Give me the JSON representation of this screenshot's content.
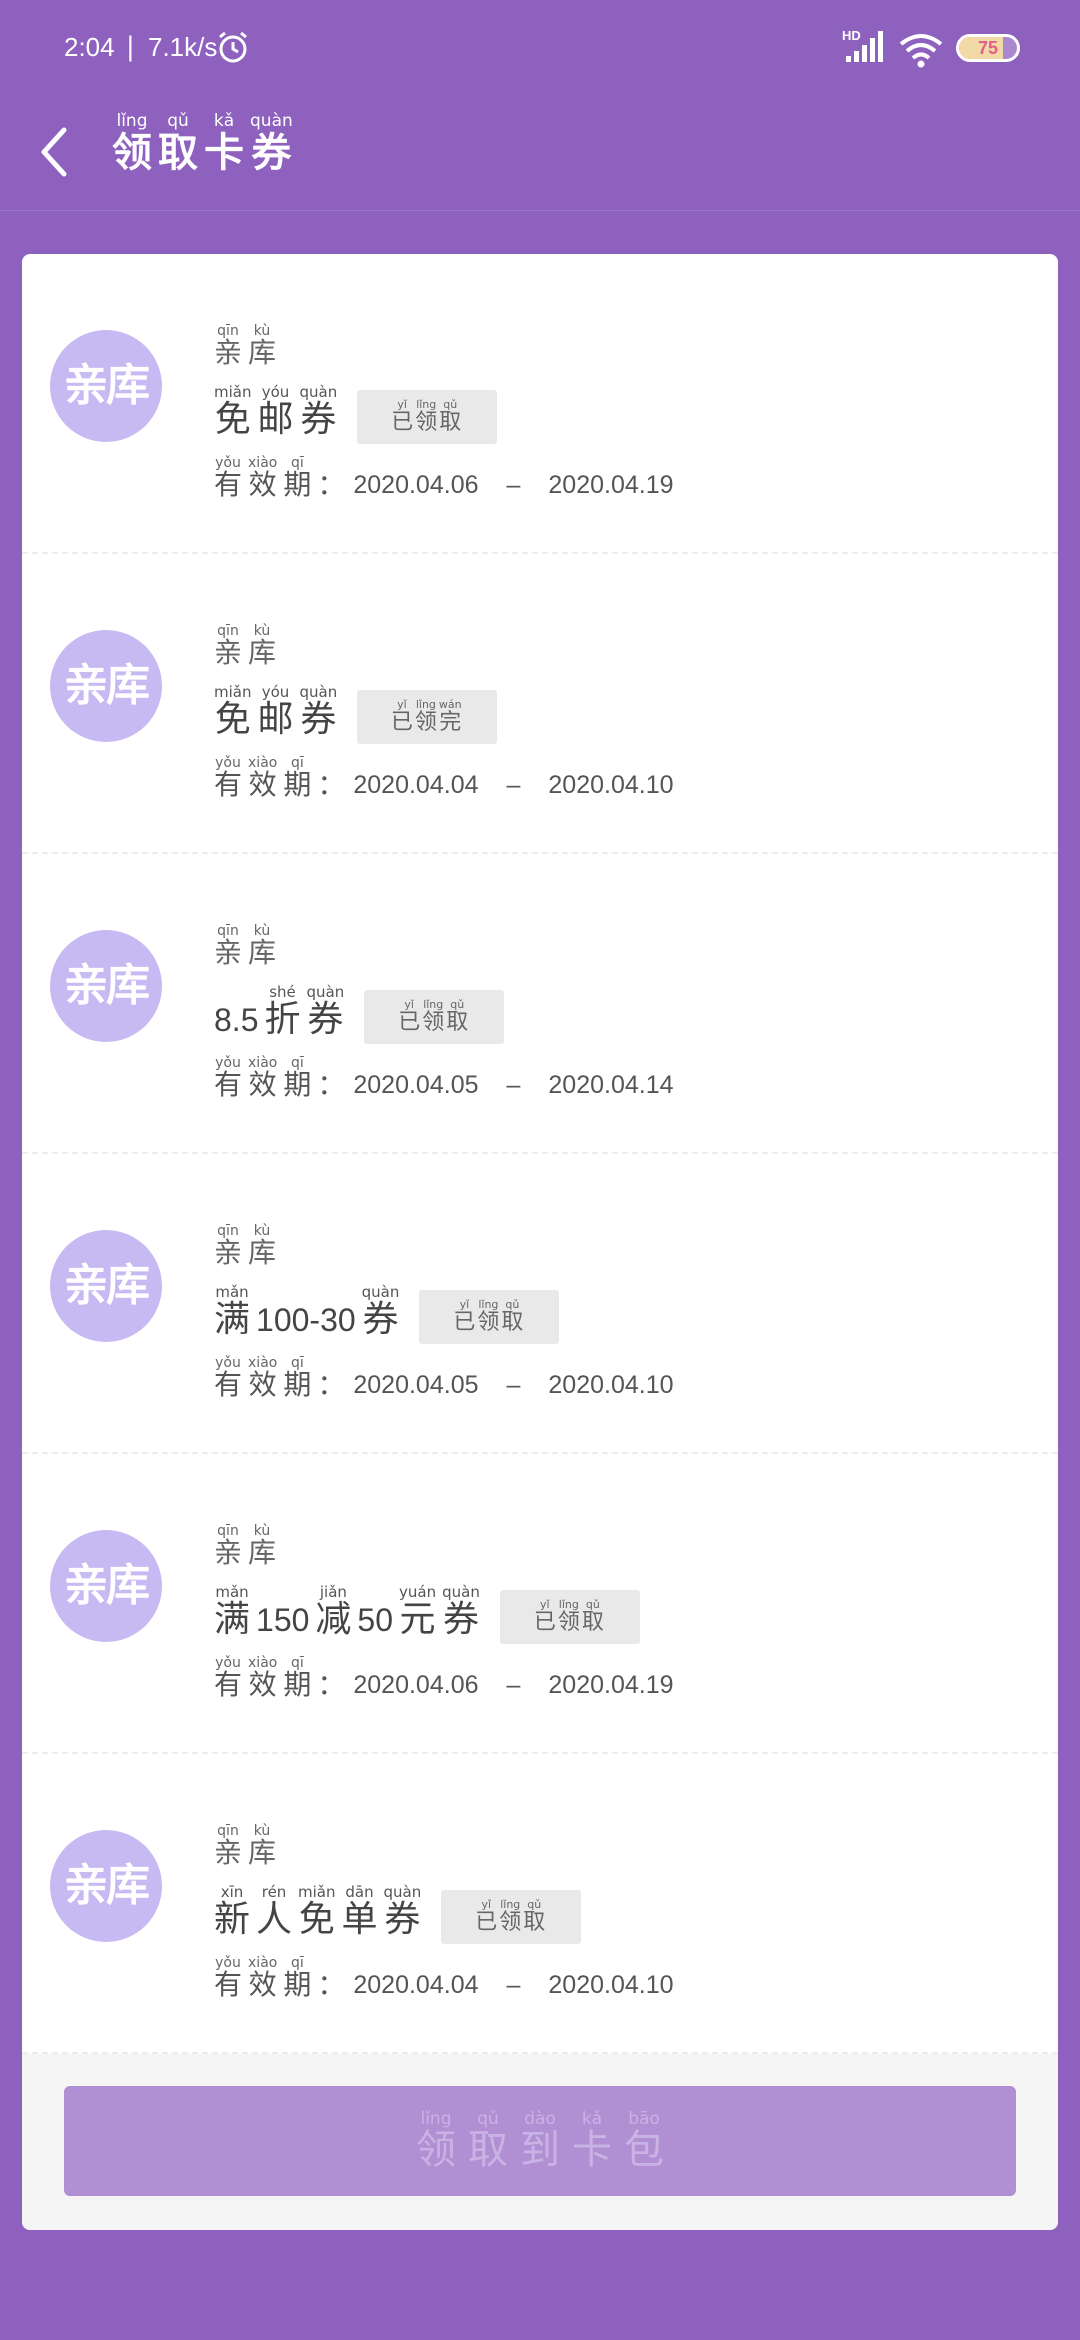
{
  "status_bar": {
    "time": "2:04",
    "separator": "|",
    "speed": "7.1k/s",
    "battery": "75",
    "battery_level": 0.75
  },
  "header": {
    "title": [
      {
        "py": "lǐng",
        "ch": "领"
      },
      {
        "py": "qǔ",
        "ch": "取"
      },
      {
        "py": "kǎ",
        "ch": "卡"
      },
      {
        "py": "quàn",
        "ch": "券"
      }
    ]
  },
  "colors": {
    "background": "#8e61bf",
    "button": "#b08fd2",
    "logo": "#c7b9f2"
  },
  "coupons": [
    {
      "logo": "亲库",
      "brand": [
        {
          "py": "qīn",
          "ch": "亲"
        },
        {
          "py": "kù",
          "ch": "库"
        }
      ],
      "name": [
        {
          "py": "miǎn",
          "ch": "免"
        },
        {
          "py": "yóu",
          "ch": "邮"
        },
        {
          "py": "quàn",
          "ch": "券"
        }
      ],
      "status": [
        {
          "py": "yǐ",
          "ch": "已"
        },
        {
          "py": "lǐng",
          "ch": "领"
        },
        {
          "py": "qǔ",
          "ch": "取"
        }
      ],
      "validity_label": [
        {
          "py": "yǒu",
          "ch": "有"
        },
        {
          "py": "xiào",
          "ch": "效"
        },
        {
          "py": "qī",
          "ch": "期"
        }
      ],
      "start": "2020.04.06",
      "end": "2020.04.19"
    },
    {
      "logo": "亲库",
      "brand": [
        {
          "py": "qīn",
          "ch": "亲"
        },
        {
          "py": "kù",
          "ch": "库"
        }
      ],
      "name": [
        {
          "py": "miǎn",
          "ch": "免"
        },
        {
          "py": "yóu",
          "ch": "邮"
        },
        {
          "py": "quàn",
          "ch": "券"
        }
      ],
      "status": [
        {
          "py": "yǐ",
          "ch": "已"
        },
        {
          "py": "lǐng",
          "ch": "领"
        },
        {
          "py": "wán",
          "ch": "完"
        }
      ],
      "validity_label": [
        {
          "py": "yǒu",
          "ch": "有"
        },
        {
          "py": "xiào",
          "ch": "效"
        },
        {
          "py": "qī",
          "ch": "期"
        }
      ],
      "start": "2020.04.04",
      "end": "2020.04.10"
    },
    {
      "logo": "亲库",
      "brand": [
        {
          "py": "qīn",
          "ch": "亲"
        },
        {
          "py": "kù",
          "ch": "库"
        }
      ],
      "name": [
        {
          "num": "8.5"
        },
        {
          "py": "shé",
          "ch": "折"
        },
        {
          "py": "quàn",
          "ch": "券"
        }
      ],
      "status": [
        {
          "py": "yǐ",
          "ch": "已"
        },
        {
          "py": "lǐng",
          "ch": "领"
        },
        {
          "py": "qǔ",
          "ch": "取"
        }
      ],
      "validity_label": [
        {
          "py": "yǒu",
          "ch": "有"
        },
        {
          "py": "xiào",
          "ch": "效"
        },
        {
          "py": "qī",
          "ch": "期"
        }
      ],
      "start": "2020.04.05",
      "end": "2020.04.14"
    },
    {
      "logo": "亲库",
      "brand": [
        {
          "py": "qīn",
          "ch": "亲"
        },
        {
          "py": "kù",
          "ch": "库"
        }
      ],
      "name": [
        {
          "py": "mǎn",
          "ch": "满"
        },
        {
          "num": "100-30"
        },
        {
          "py": "quàn",
          "ch": "券"
        }
      ],
      "status": [
        {
          "py": "yǐ",
          "ch": "已"
        },
        {
          "py": "lǐng",
          "ch": "领"
        },
        {
          "py": "qǔ",
          "ch": "取"
        }
      ],
      "validity_label": [
        {
          "py": "yǒu",
          "ch": "有"
        },
        {
          "py": "xiào",
          "ch": "效"
        },
        {
          "py": "qī",
          "ch": "期"
        }
      ],
      "start": "2020.04.05",
      "end": "2020.04.10"
    },
    {
      "logo": "亲库",
      "brand": [
        {
          "py": "qīn",
          "ch": "亲"
        },
        {
          "py": "kù",
          "ch": "库"
        }
      ],
      "name": [
        {
          "py": "mǎn",
          "ch": "满"
        },
        {
          "num": "150"
        },
        {
          "py": "jiǎn",
          "ch": "减"
        },
        {
          "num": "50"
        },
        {
          "py": "yuán",
          "ch": "元"
        },
        {
          "py": "quàn",
          "ch": "券"
        }
      ],
      "status": [
        {
          "py": "yǐ",
          "ch": "已"
        },
        {
          "py": "lǐng",
          "ch": "领"
        },
        {
          "py": "qǔ",
          "ch": "取"
        }
      ],
      "validity_label": [
        {
          "py": "yǒu",
          "ch": "有"
        },
        {
          "py": "xiào",
          "ch": "效"
        },
        {
          "py": "qī",
          "ch": "期"
        }
      ],
      "start": "2020.04.06",
      "end": "2020.04.19"
    },
    {
      "logo": "亲库",
      "brand": [
        {
          "py": "qīn",
          "ch": "亲"
        },
        {
          "py": "kù",
          "ch": "库"
        }
      ],
      "name": [
        {
          "py": "xīn",
          "ch": "新"
        },
        {
          "py": "rén",
          "ch": "人"
        },
        {
          "py": "miǎn",
          "ch": "免"
        },
        {
          "py": "dān",
          "ch": "单"
        },
        {
          "py": "quàn",
          "ch": "券"
        }
      ],
      "status": [
        {
          "py": "yǐ",
          "ch": "已"
        },
        {
          "py": "lǐng",
          "ch": "领"
        },
        {
          "py": "qǔ",
          "ch": "取"
        }
      ],
      "validity_label": [
        {
          "py": "yǒu",
          "ch": "有"
        },
        {
          "py": "xiào",
          "ch": "效"
        },
        {
          "py": "qī",
          "ch": "期"
        }
      ],
      "start": "2020.04.04",
      "end": "2020.04.10"
    }
  ],
  "colon": "：",
  "dash": "–",
  "footer": {
    "button": [
      {
        "py": "lǐng",
        "ch": "领"
      },
      {
        "py": "qǔ",
        "ch": "取"
      },
      {
        "py": "dào",
        "ch": "到"
      },
      {
        "py": "kǎ",
        "ch": "卡"
      },
      {
        "py": "bāo",
        "ch": "包"
      }
    ]
  }
}
